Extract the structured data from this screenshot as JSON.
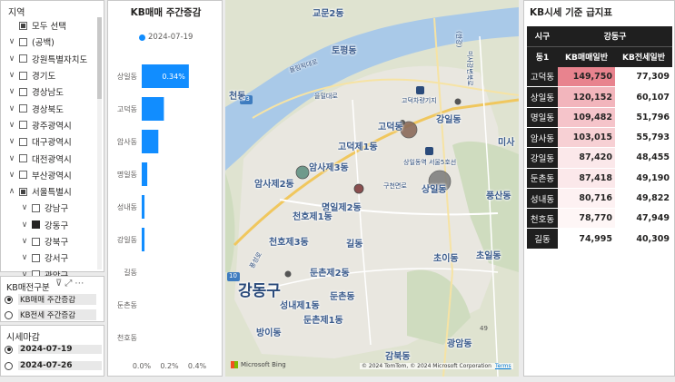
{
  "region_slicer": {
    "title": "지역",
    "items": [
      {
        "label": "모두 선택",
        "state": "partial",
        "chevron": ""
      },
      {
        "label": "(공백)",
        "state": "off",
        "chevron": "∨"
      },
      {
        "label": "강원특별자치도",
        "state": "off",
        "chevron": "∨"
      },
      {
        "label": "경기도",
        "state": "off",
        "chevron": "∨"
      },
      {
        "label": "경상남도",
        "state": "off",
        "chevron": "∨"
      },
      {
        "label": "경상북도",
        "state": "off",
        "chevron": "∨"
      },
      {
        "label": "광주광역시",
        "state": "off",
        "chevron": "∨"
      },
      {
        "label": "대구광역시",
        "state": "off",
        "chevron": "∨"
      },
      {
        "label": "대전광역시",
        "state": "off",
        "chevron": "∨"
      },
      {
        "label": "부산광역시",
        "state": "off",
        "chevron": "∨"
      },
      {
        "label": "서울특별시",
        "state": "partial",
        "chevron": "∧"
      },
      {
        "label": "강남구",
        "state": "off",
        "chevron": "∨",
        "indent": true
      },
      {
        "label": "강동구",
        "state": "on",
        "chevron": "∨",
        "indent": true
      },
      {
        "label": "강북구",
        "state": "off",
        "chevron": "∨",
        "indent": true
      },
      {
        "label": "강서구",
        "state": "off",
        "chevron": "∨",
        "indent": true
      },
      {
        "label": "관악구",
        "state": "off",
        "chevron": "∨",
        "indent": true
      }
    ]
  },
  "kb_type_slicer": {
    "title": "KB매전구분",
    "icons": [
      "filter-icon",
      "expand-icon",
      "more-icon"
    ],
    "options": [
      {
        "label": "KB매매 주간증감",
        "selected": true
      },
      {
        "label": "KB전세 주간증감",
        "selected": false
      }
    ]
  },
  "date_slicer": {
    "title": "시세마감",
    "options": [
      {
        "label": "2024-07-19",
        "selected": true
      },
      {
        "label": "2024-07-26",
        "selected": false
      }
    ]
  },
  "bar_chart": {
    "title": "KB매매 주간증감",
    "legend": "2024-07-19",
    "bar_color": "#118dff",
    "data_label": "0.34%"
  },
  "chart_data": {
    "type": "bar",
    "orientation": "horizontal",
    "title": "KB매매 주간증감",
    "legend": [
      "2024-07-19"
    ],
    "categories": [
      "상일동",
      "고덕동",
      "암사동",
      "명일동",
      "성내동",
      "강일동",
      "길동",
      "둔촌동",
      "천호동"
    ],
    "series": [
      {
        "name": "2024-07-19",
        "values": [
          0.34,
          0.16,
          0.12,
          0.04,
          0.02,
          0.02,
          0.0,
          0.0,
          0.0
        ]
      }
    ],
    "xlim": [
      0,
      0.4
    ],
    "xticks": [
      "0.0%",
      "0.2%",
      "0.4%"
    ],
    "data_labels": {
      "상일동": "0.34%"
    },
    "grid": false
  },
  "map": {
    "labels": [
      {
        "text": "교문2동",
        "cls": "small"
      },
      {
        "text": "토평동",
        "cls": "small"
      },
      {
        "text": "천동",
        "cls": "small"
      },
      {
        "text": "을밀대로",
        "cls": "poi"
      },
      {
        "text": "고덕차량기지",
        "cls": "poi"
      },
      {
        "text": "고덕동",
        "cls": "small"
      },
      {
        "text": "강일동",
        "cls": "small"
      },
      {
        "text": "고덕제1동",
        "cls": "small"
      },
      {
        "text": "미사",
        "cls": "small"
      },
      {
        "text": "암사제3동",
        "cls": "small"
      },
      {
        "text": "상일동역 서울5호선",
        "cls": "poi"
      },
      {
        "text": "구천면로",
        "cls": "poi"
      },
      {
        "text": "상일동",
        "cls": "small"
      },
      {
        "text": "암사제2동",
        "cls": "small"
      },
      {
        "text": "명일제2동",
        "cls": "small"
      },
      {
        "text": "풍산동",
        "cls": "small"
      },
      {
        "text": "천호제1동",
        "cls": "small"
      },
      {
        "text": "천호제3동",
        "cls": "small"
      },
      {
        "text": "길동",
        "cls": "small"
      },
      {
        "text": "초이동",
        "cls": "small"
      },
      {
        "text": "초일동",
        "cls": "small"
      },
      {
        "text": "둔촌제2동",
        "cls": "small"
      },
      {
        "text": "강동구",
        "cls": "big"
      },
      {
        "text": "성내제1동",
        "cls": "small"
      },
      {
        "text": "둔촌동",
        "cls": "small"
      },
      {
        "text": "둔촌제1동",
        "cls": "small"
      },
      {
        "text": "방이동",
        "cls": "small"
      },
      {
        "text": "감북동",
        "cls": "small"
      },
      {
        "text": "광암동",
        "cls": "small"
      },
      {
        "text": "(한강)",
        "cls": "poi"
      },
      {
        "text": "미사강변북로",
        "cls": "poi"
      },
      {
        "text": "올림픽대로",
        "cls": "poi"
      },
      {
        "text": "풍성로",
        "cls": "poi"
      }
    ],
    "road_numbers": [
      "43",
      "10",
      "49"
    ],
    "ms_logo": "Microsoft Bing",
    "attribution": "© 2024 TomTom, © 2024 Microsoft Corporation",
    "terms": "Terms"
  },
  "table": {
    "title": "KB시세 기준 급지표",
    "header_sigungu": "시구",
    "header_gu": "강동구",
    "header_dong": "동1",
    "header_sale": "KB매매일반",
    "header_jeonse": "KB전세일반",
    "rows": [
      {
        "dong": "고덕동",
        "sale": "149,750",
        "jeonse": "77,309",
        "sale_bg": "#e8838e"
      },
      {
        "dong": "상일동",
        "sale": "120,152",
        "jeonse": "60,107",
        "sale_bg": "#f2b5bc"
      },
      {
        "dong": "명일동",
        "sale": "109,482",
        "jeonse": "51,796",
        "sale_bg": "#f5c4ca"
      },
      {
        "dong": "암사동",
        "sale": "103,015",
        "jeonse": "55,793",
        "sale_bg": "#f7d0d4"
      },
      {
        "dong": "강일동",
        "sale": "87,420",
        "jeonse": "48,455",
        "sale_bg": "#fbe8ea"
      },
      {
        "dong": "둔촌동",
        "sale": "87,418",
        "jeonse": "49,190",
        "sale_bg": "#fbe8ea"
      },
      {
        "dong": "성내동",
        "sale": "80,716",
        "jeonse": "49,822",
        "sale_bg": "#fdf1f2"
      },
      {
        "dong": "천호동",
        "sale": "78,770",
        "jeonse": "47,949",
        "sale_bg": "#fef6f6"
      },
      {
        "dong": "길동",
        "sale": "74,995",
        "jeonse": "40,309",
        "sale_bg": "#ffffff"
      }
    ]
  }
}
